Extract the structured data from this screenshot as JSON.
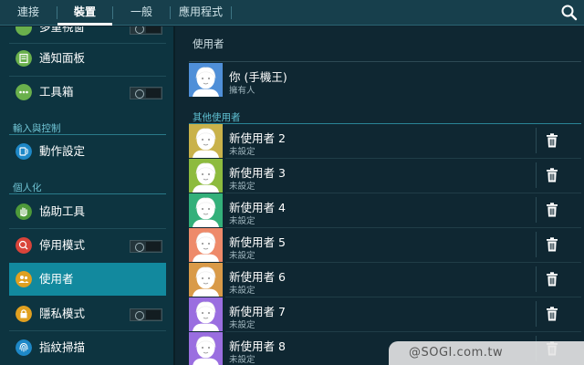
{
  "tabs": [
    {
      "label": "連接",
      "active": false
    },
    {
      "label": "裝置",
      "active": true
    },
    {
      "label": "一般",
      "active": false
    },
    {
      "label": "應用程式",
      "active": false
    }
  ],
  "left_panel": {
    "items_top": [
      {
        "label": "多重視窗",
        "icon": "multi-window-icon",
        "color": "#6ab04c",
        "toggle": true
      },
      {
        "label": "通知面板",
        "icon": "notification-panel-icon",
        "color": "#6ab04c",
        "toggle": false
      },
      {
        "label": "工具箱",
        "icon": "toolbox-icon",
        "color": "#6ab04c",
        "toggle": true
      }
    ],
    "section_input": "輸入與控制",
    "items_input": [
      {
        "label": "動作設定",
        "icon": "motion-icon",
        "color": "#1e88c7",
        "toggle": false
      }
    ],
    "section_personal": "個人化",
    "items_personal": [
      {
        "label": "協助工具",
        "icon": "hand-icon",
        "color": "#4e9a3a",
        "toggle": false
      },
      {
        "label": "停用模式",
        "icon": "blocking-mode-icon",
        "color": "#d9443a",
        "toggle": true
      },
      {
        "label": "使用者",
        "icon": "users-icon",
        "color": "#e0a020",
        "toggle": false,
        "active": true
      },
      {
        "label": "隱私模式",
        "icon": "lock-icon",
        "color": "#e0a020",
        "toggle": true
      },
      {
        "label": "指紋掃描",
        "icon": "fingerprint-icon",
        "color": "#1e88c7",
        "toggle": false
      }
    ]
  },
  "right_panel": {
    "title": "使用者",
    "owner": {
      "name": "你 (手機王)",
      "role": "擁有人",
      "bg": "#4f8fd8"
    },
    "others_header": "其他使用者",
    "users": [
      {
        "name": "新使用者 2",
        "status": "未設定",
        "bg": "#c9b24a"
      },
      {
        "name": "新使用者 3",
        "status": "未設定",
        "bg": "#8dbb3e"
      },
      {
        "name": "新使用者 4",
        "status": "未設定",
        "bg": "#33b07a"
      },
      {
        "name": "新使用者 5",
        "status": "未設定",
        "bg": "#ee8a6a"
      },
      {
        "name": "新使用者 6",
        "status": "未設定",
        "bg": "#d99a48"
      },
      {
        "name": "新使用者 7",
        "status": "未設定",
        "bg": "#9a6ee0"
      },
      {
        "name": "新使用者 8",
        "status": "未設定",
        "bg": "#9a6ee0"
      }
    ]
  },
  "watermark": "@SOGI.com.tw"
}
